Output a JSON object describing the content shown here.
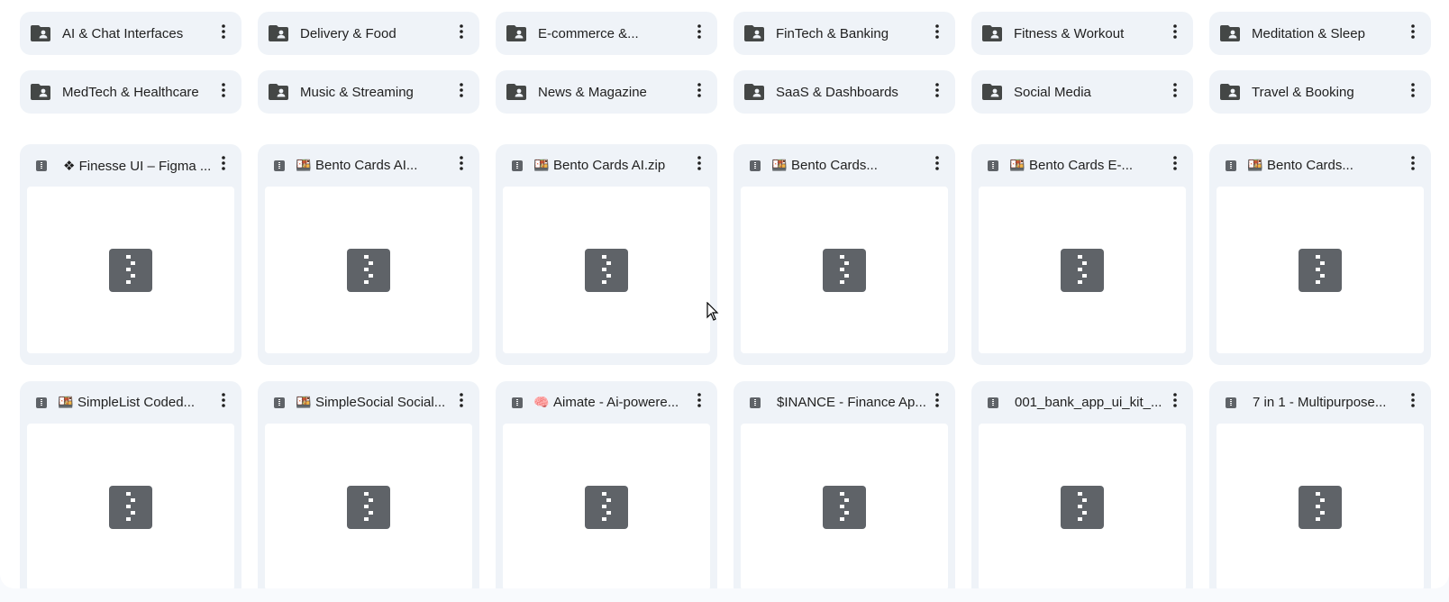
{
  "folders": [
    {
      "name": "AI & Chat Interfaces"
    },
    {
      "name": "Delivery & Food"
    },
    {
      "name": "E-commerce &..."
    },
    {
      "name": "FinTech & Banking"
    },
    {
      "name": "Fitness & Workout"
    },
    {
      "name": "Meditation & Sleep"
    },
    {
      "name": "MedTech & Healthcare"
    },
    {
      "name": "Music & Streaming"
    },
    {
      "name": "News & Magazine"
    },
    {
      "name": "SaaS & Dashboards"
    },
    {
      "name": "Social Media"
    },
    {
      "name": "Travel & Booking"
    }
  ],
  "files": [
    {
      "lead": "",
      "name": "❖ Finesse UI – Figma ..."
    },
    {
      "lead": "🍱",
      "name": "Bento Cards AI..."
    },
    {
      "lead": "🍱",
      "name": "Bento Cards AI.zip"
    },
    {
      "lead": "🍱",
      "name": "Bento Cards..."
    },
    {
      "lead": "🍱",
      "name": "Bento Cards E-..."
    },
    {
      "lead": "🍱",
      "name": "Bento Cards..."
    },
    {
      "lead": "🍱",
      "name": "SimpleList Coded..."
    },
    {
      "lead": "🍱",
      "name": "SimpleSocial Social..."
    },
    {
      "lead": "🧠",
      "name": "Aimate - Ai-powere..."
    },
    {
      "lead": "",
      "name": "$INANCE - Finance Ap..."
    },
    {
      "lead": "",
      "name": "001_bank_app_ui_kit_..."
    },
    {
      "lead": "",
      "name": "7 in 1 - Multipurpose..."
    }
  ],
  "icons": {
    "folder": "shared-folder-icon",
    "more": "more-vert-icon",
    "zip": "zip-file-icon"
  },
  "colors": {
    "card_bg": "#eff3f8",
    "icon": "#444746",
    "zip": "#5f6368"
  }
}
